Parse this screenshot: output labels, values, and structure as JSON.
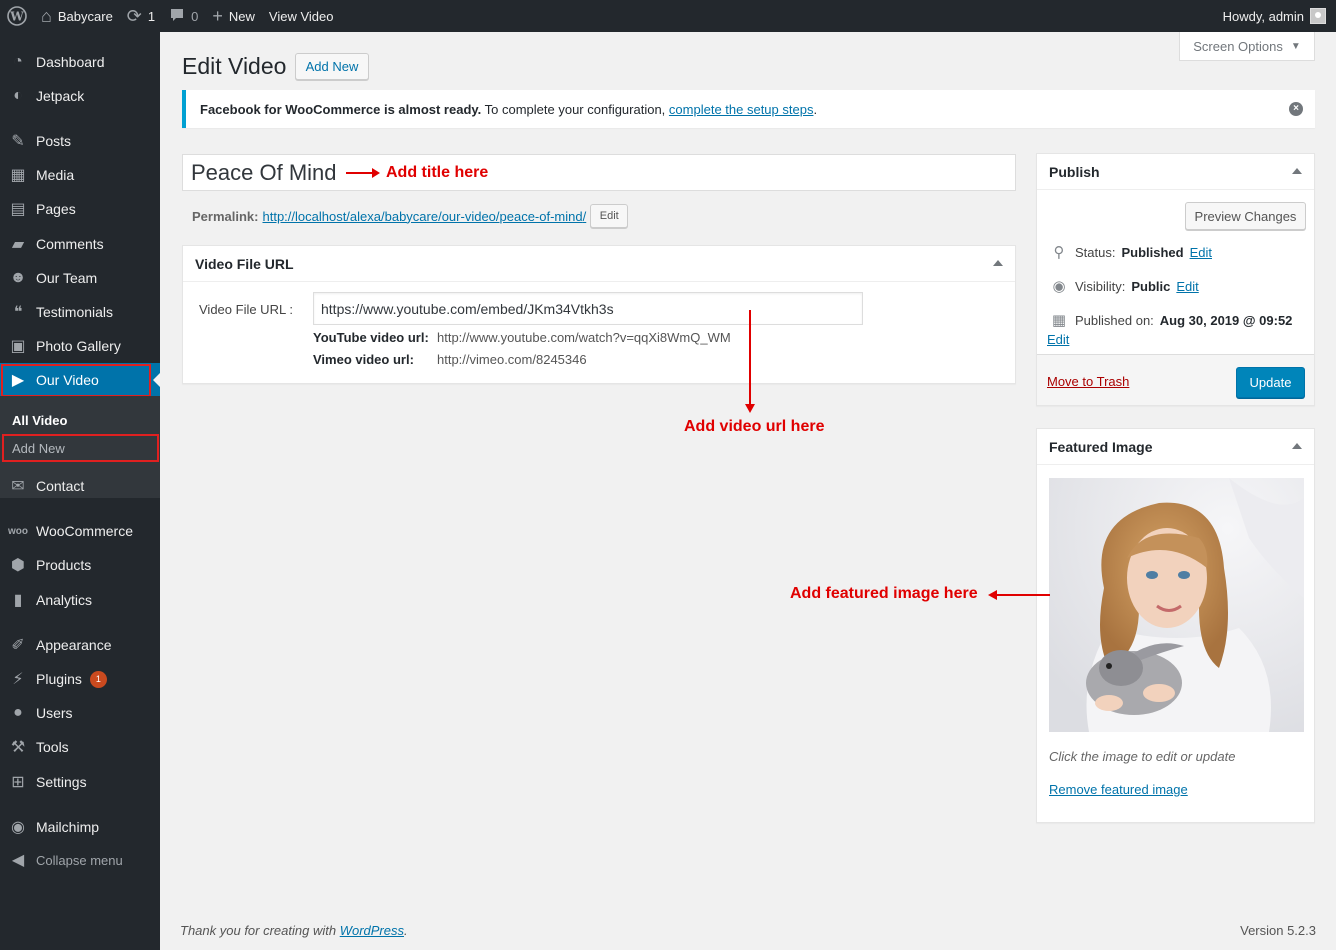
{
  "adminbar": {
    "site_name": "Babycare",
    "updates_count": "1",
    "comments_count": "0",
    "new_label": "New",
    "view_label": "View Video",
    "howdy": "Howdy, admin"
  },
  "sidebar": {
    "items": [
      {
        "label": "Dashboard",
        "icon": "dashboard-icon"
      },
      {
        "label": "Jetpack",
        "icon": "jetpack-icon"
      },
      {
        "label": "Posts",
        "icon": "pin-icon"
      },
      {
        "label": "Media",
        "icon": "media-icon"
      },
      {
        "label": "Pages",
        "icon": "pages-icon"
      },
      {
        "label": "Comments",
        "icon": "comments-icon"
      },
      {
        "label": "Our Team",
        "icon": "groups-icon"
      },
      {
        "label": "Testimonials",
        "icon": "quote-icon"
      },
      {
        "label": "Photo Gallery",
        "icon": "gallery-icon"
      },
      {
        "label": "Our Video",
        "icon": "video-icon"
      },
      {
        "label": "Contact",
        "icon": "email-icon"
      },
      {
        "label": "WooCommerce",
        "icon": "woo-icon"
      },
      {
        "label": "Products",
        "icon": "products-icon"
      },
      {
        "label": "Analytics",
        "icon": "analytics-icon"
      },
      {
        "label": "Appearance",
        "icon": "appearance-icon"
      },
      {
        "label": "Plugins",
        "icon": "plugins-icon",
        "badge": "1"
      },
      {
        "label": "Users",
        "icon": "users-icon"
      },
      {
        "label": "Tools",
        "icon": "tools-icon"
      },
      {
        "label": "Settings",
        "icon": "settings-icon"
      },
      {
        "label": "Mailchimp",
        "icon": "mailchimp-icon"
      },
      {
        "label": "Collapse menu",
        "icon": "collapse-icon"
      }
    ],
    "submenu": [
      "All Video",
      "Add New"
    ]
  },
  "header": {
    "title": "Edit Video",
    "add_new": "Add New",
    "screen_options": "Screen Options"
  },
  "notice": {
    "bold": "Facebook for WooCommerce is almost ready.",
    "text": " To complete your configuration, ",
    "link": "complete the setup steps",
    "end": "."
  },
  "post": {
    "title": "Peace Of Mind",
    "permalink_label": "Permalink:",
    "permalink_base": "http://localhost/alexa/babycare/our-video/",
    "permalink_slug": "peace-of-mind",
    "permalink_end": "/",
    "permalink_edit": "Edit"
  },
  "video_box": {
    "title": "Video File URL",
    "label": "Video File URL :",
    "value": "https://www.youtube.com/embed/JKm34Vtkh3s",
    "youtube_label": "YouTube video url:",
    "youtube_example": "http://www.youtube.com/watch?v=qqXi8WmQ_WM",
    "vimeo_label": "Vimeo video url:",
    "vimeo_example": "http://vimeo.com/8245346"
  },
  "publish": {
    "title": "Publish",
    "preview": "Preview Changes",
    "status_label": "Status:",
    "status_value": "Published",
    "visibility_label": "Visibility:",
    "visibility_value": "Public",
    "published_label": "Published on:",
    "published_value": "Aug 30, 2019 @ 09:52",
    "edit": "Edit",
    "trash": "Move to Trash",
    "update": "Update"
  },
  "featured": {
    "title": "Featured Image",
    "caption": "Click the image to edit or update",
    "remove": "Remove featured image"
  },
  "annotations": {
    "title_hint": "Add title here",
    "url_hint": "Add video url here",
    "image_hint": "Add featured image here"
  },
  "footer": {
    "thanks": "Thank you for creating with ",
    "wp_link": "WordPress",
    "thanks_end": ".",
    "version": "Version 5.2.3"
  },
  "colors": {
    "admin_dark": "#23282d",
    "primary": "#0085ba",
    "annotation_red": "#e00000"
  }
}
